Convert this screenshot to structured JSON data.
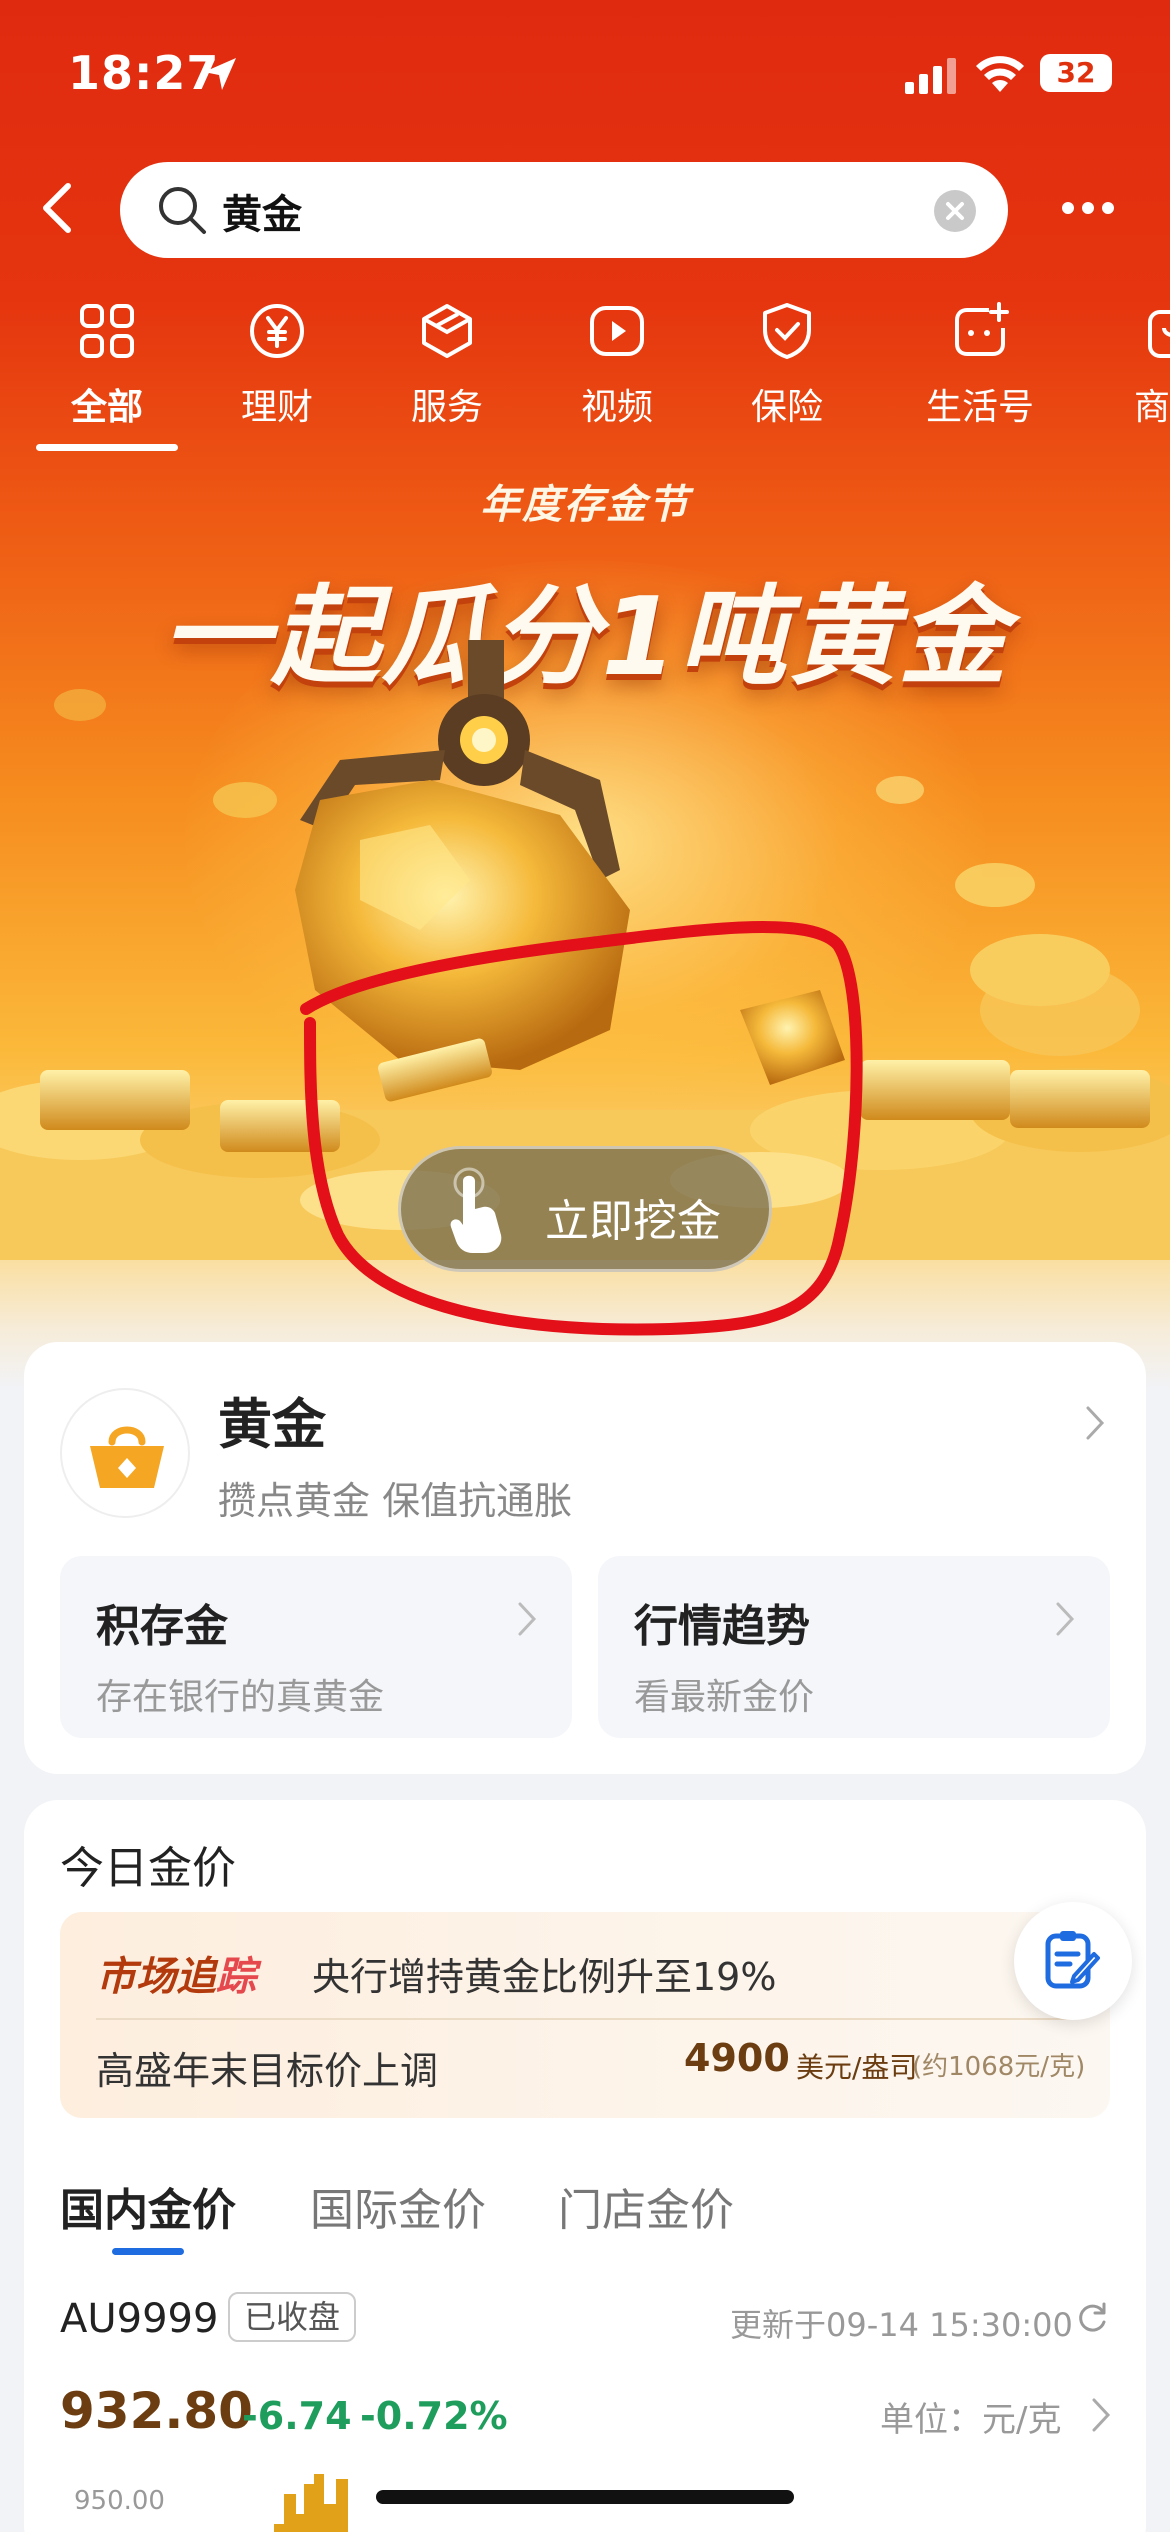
{
  "status_bar": {
    "time": "18:27",
    "battery": "32"
  },
  "search": {
    "query": "黄金"
  },
  "categories": [
    {
      "label": "全部",
      "icon": "grid-icon",
      "active": true
    },
    {
      "label": "理财",
      "icon": "yen-coin-icon"
    },
    {
      "label": "服务",
      "icon": "cube-icon"
    },
    {
      "label": "视频",
      "icon": "play-icon"
    },
    {
      "label": "保险",
      "icon": "shield-icon"
    },
    {
      "label": "生活号",
      "icon": "chat-plus-icon"
    },
    {
      "label": "商",
      "icon": "bag-icon"
    }
  ],
  "banner": {
    "subtitle": "年度存金节",
    "title": "一起瓜分1吨黄金",
    "cta": "立即挖金"
  },
  "gold_card": {
    "title": "黄金",
    "desc": "攒点黄金 保值抗通胀",
    "items": [
      {
        "title": "积存金",
        "desc": "存在银行的真黄金"
      },
      {
        "title": "行情趋势",
        "desc": "看最新金价"
      }
    ]
  },
  "today_price": {
    "heading": "今日金价",
    "news": {
      "tag_part1": "市场追",
      "tag_part2": "踪",
      "headline": "央行增持黄金比例升至19%",
      "line2": "高盛年末目标价上调",
      "value": "4900",
      "unit": "美元/盎司",
      "approx": "(约1068元/克)"
    },
    "tabs": [
      "国内金价",
      "国际金价",
      "门店金价"
    ],
    "symbol": "AU9999",
    "status_badge": "已收盘",
    "updated": "更新于09-14 15:30:00",
    "price": "932.80",
    "change": "-6.74",
    "change_pct": "-0.72%",
    "unit": "单位：元/克",
    "y_tick": "950.00"
  },
  "colors": {
    "brand_red": "#e02a10",
    "gold": "#f5a623",
    "down_green": "#1e9d5c",
    "tab_blue": "#1f6ce0"
  }
}
